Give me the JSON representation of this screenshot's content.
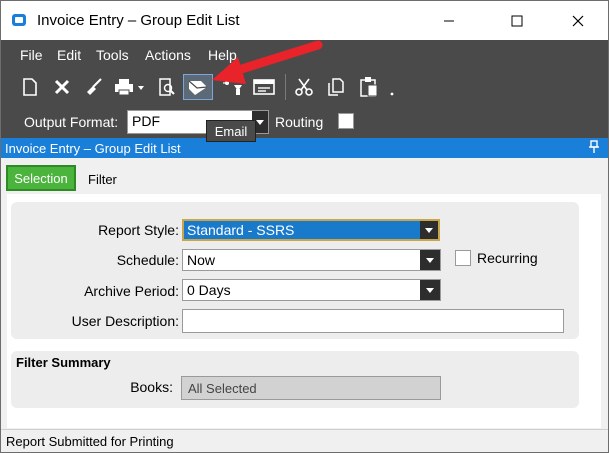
{
  "window": {
    "title": "Invoice Entry – Group Edit List",
    "minimize_glyph": "—",
    "maximize_glyph": "☐",
    "close_glyph": "✕"
  },
  "menu": {
    "items": [
      "File",
      "Edit",
      "Tools",
      "Actions",
      "Help"
    ]
  },
  "toolbar": {
    "icons": [
      "new-icon",
      "delete-icon",
      "clear-icon",
      "print-icon",
      "print-preview-icon",
      "email-icon",
      "generate-icon",
      "schedule-icon",
      "cut-icon",
      "copy-icon",
      "paste-icon"
    ],
    "tooltip": "Email",
    "output_format_label": "Output Format:",
    "output_format_value": "PDF",
    "routing_label": "Routing",
    "routing_checked": false
  },
  "panel": {
    "title": "Invoice Entry – Group Edit List"
  },
  "tabs": {
    "selection": "Selection",
    "filter": "Filter"
  },
  "form": {
    "report_style_label": "Report Style:",
    "report_style_value": "Standard - SSRS",
    "schedule_label": "Schedule:",
    "schedule_value": "Now",
    "recurring_label": "Recurring",
    "recurring_checked": false,
    "archive_period_label": "Archive Period:",
    "archive_period_value": "0 Days",
    "user_description_label": "User Description:",
    "user_description_value": ""
  },
  "filter_summary": {
    "heading": "Filter Summary",
    "books_label": "Books:",
    "books_value": "All Selected"
  },
  "status": {
    "text": "Report Submitted for Printing"
  },
  "colors": {
    "toolbar_bg": "#4a4a4a",
    "panel_header": "#1a7fd9",
    "selected_tab": "#4bb43d",
    "highlight": "#1979ca",
    "annotation_arrow": "#e8232a"
  }
}
